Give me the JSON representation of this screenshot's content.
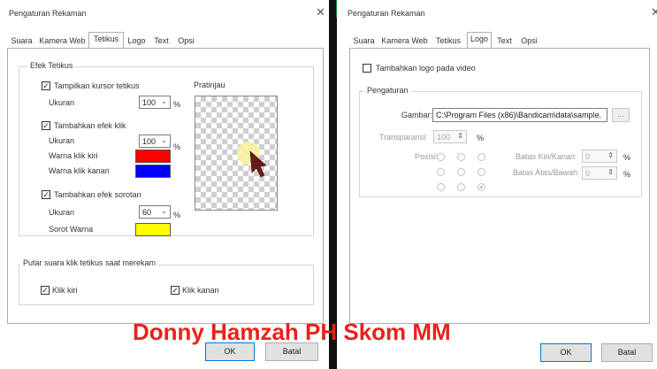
{
  "left_window": {
    "title": "Pengaturan Rekaman",
    "tabs": [
      "Suara",
      "Kamera Web",
      "Tetikus",
      "Logo",
      "Text",
      "Opsi"
    ],
    "active_tab": "Tetikus",
    "group_mouse_effect": "Efek Tetikus",
    "show_cursor": {
      "label": "Tampilkan kursor tetikus",
      "checked": true,
      "size_label": "Ukuran",
      "size_value": "100",
      "unit": "%"
    },
    "click_effect": {
      "label": "Tambahkan efek klik",
      "checked": true,
      "size_label": "Ukuran",
      "size_value": "100",
      "unit": "%",
      "left_color_label": "Warna klik kiri",
      "left_color": "#ff0000",
      "right_color_label": "Warna klik kanan",
      "right_color": "#0000ff"
    },
    "highlight_effect": {
      "label": "Tambahkan efek sorotan",
      "checked": true,
      "size_label": "Ukuran",
      "size_value": "60",
      "unit": "%",
      "color_label": "Sorot Warna",
      "color": "#ffff00"
    },
    "preview_label": "Pratinjau",
    "group_click_sound": "Putar suara klik tetikus saat merekam",
    "left_click": {
      "label": "Klik kiri",
      "checked": true
    },
    "right_click": {
      "label": "Klik kanan",
      "checked": true
    },
    "ok_label": "OK",
    "cancel_label": "Batal"
  },
  "right_window": {
    "title": "Pengaturan Rekaman",
    "tabs": [
      "Suara",
      "Kamera Web",
      "Tetikus",
      "Logo",
      "Text",
      "Opsi"
    ],
    "active_tab": "Logo",
    "add_logo": {
      "label": "Tambahkan logo pada video",
      "checked": false
    },
    "group_settings": "Pengaturan",
    "image_label": "Gambar:",
    "image_path": "C:\\Program Files (x86)\\Bandicam\\data\\sample.",
    "browse_label": "...",
    "transparency_label": "Transparansi:",
    "transparency_value": "100",
    "transparency_unit": "%",
    "position_label": "Posisi:",
    "h_margin_label": "Batas Kiri/Kanan:",
    "h_margin_value": "0",
    "v_margin_label": "Batas Atas/Bawah:",
    "v_margin_value": "0",
    "margin_unit": "%",
    "ok_label": "OK",
    "cancel_label": "Batal"
  },
  "watermark": "Donny Hamzah PH Skom MM"
}
